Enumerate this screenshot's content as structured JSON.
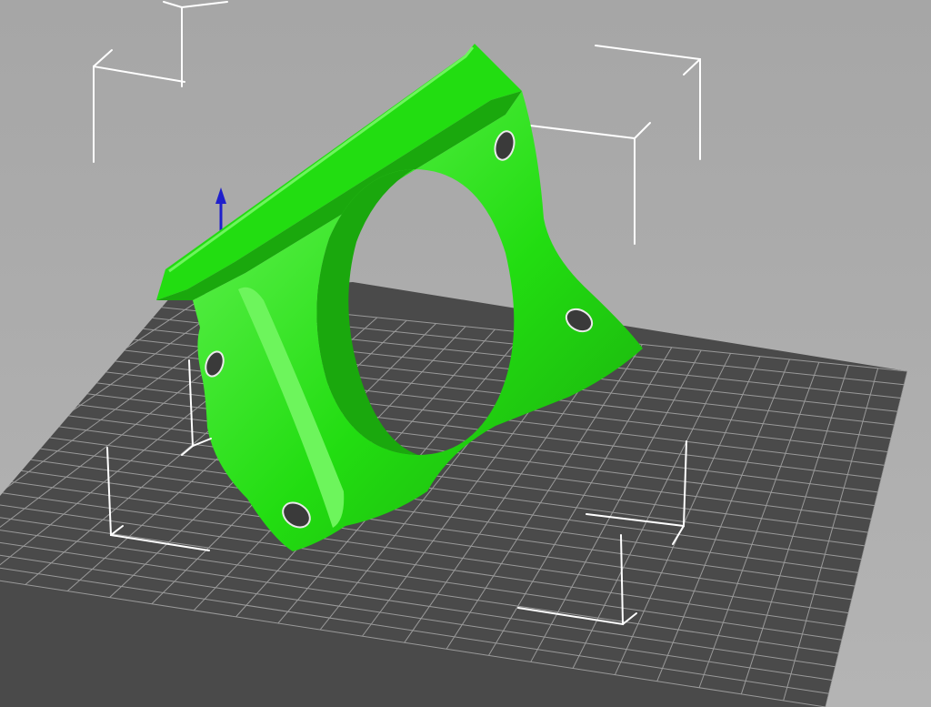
{
  "viewport": {
    "background_top": "#a6a6a6",
    "background_bottom": "#b4b4b4"
  },
  "bed": {
    "plate_color": "#4a4a4a",
    "grid_color": "#9a9a9a"
  },
  "bounding_box": {
    "color": "#ffffff"
  },
  "model": {
    "color": "#22dd11",
    "shade_color": "#1aa80d",
    "highlight_color": "#6df55c",
    "hole_color": "#3a3a3a"
  },
  "axis_gizmo": {
    "z_axis_color": "#1f1fcc"
  }
}
